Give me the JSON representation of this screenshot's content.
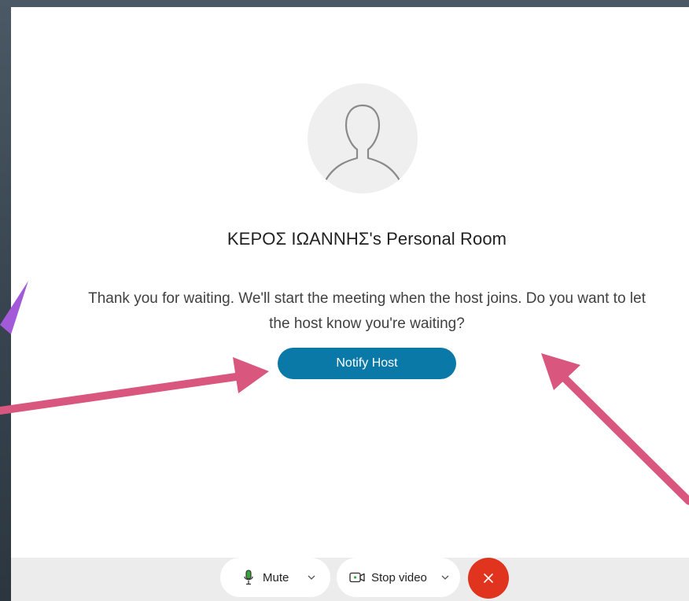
{
  "meeting": {
    "room_title": "ΚΕΡΟΣ ΙΩΑΝΝΗΣ's Personal Room",
    "wait_message": "Thank you for waiting. We'll start the meeting when the host joins. Do you want to let the host know you're waiting?",
    "notify_button": "Notify Host"
  },
  "controls": {
    "mute_label": "Mute",
    "video_label": "Stop video"
  },
  "icons": {
    "avatar": "user-silhouette-icon",
    "mute": "microphone-icon",
    "video": "video-camera-icon",
    "chevron": "chevron-down-icon",
    "end": "close-icon"
  },
  "colors": {
    "primary_button": "#0a79a8",
    "end_call": "#e0341f",
    "annotation_arrow": "#d9567e",
    "annotation_arrow_alt": "#a35ad8",
    "mic_active": "#3aa23a"
  }
}
